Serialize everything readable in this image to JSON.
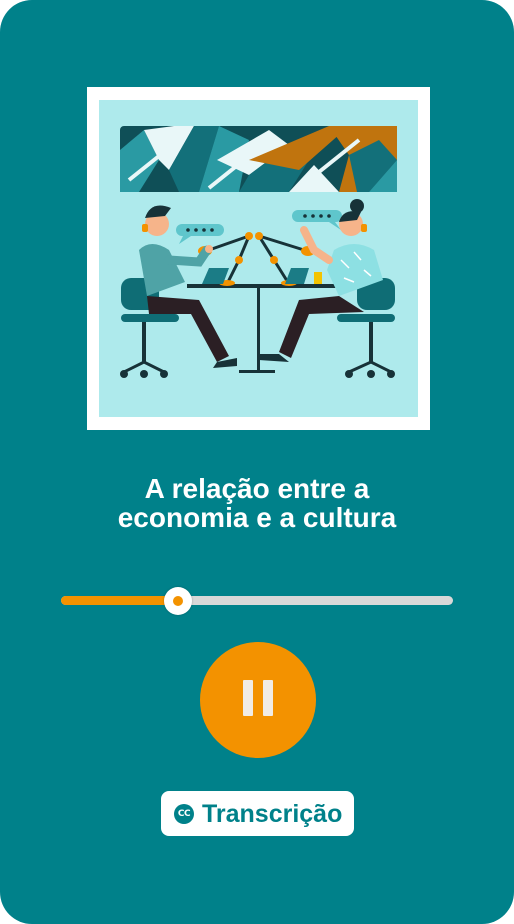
{
  "episode": {
    "title_line1": "A relação entre a",
    "title_line2": "economia e a cultura"
  },
  "player": {
    "progress": 0.299,
    "state": "playing",
    "button_icon": "pause-icon"
  },
  "transcript_button": {
    "icon": "closed-captions-icon",
    "icon_text": "CC",
    "label": "Transcrição"
  },
  "colors": {
    "background": "#00818a",
    "accent": "#f39200",
    "track": "#d8d8d8",
    "cover_bg": "#aeeaec"
  }
}
